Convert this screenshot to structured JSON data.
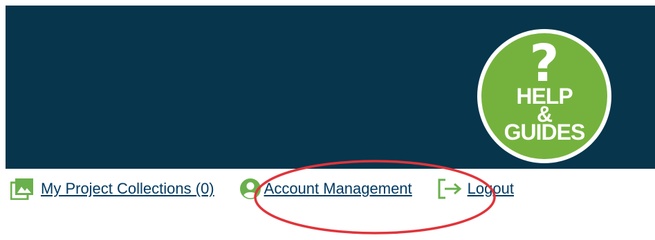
{
  "header": {
    "background_color": "#06354c",
    "help_badge": {
      "symbol": "?",
      "line1": "HELP",
      "line2": "&",
      "line3": "GUIDES",
      "color": "#75b23d",
      "icon": "question-mark-icon"
    }
  },
  "nav": {
    "collections": {
      "label": "My Project Collections (0)",
      "icon": "image-gallery-icon"
    },
    "account": {
      "label": "Account Management",
      "icon": "user-circle-icon"
    },
    "logout": {
      "label": "Logout",
      "icon": "logout-arrow-icon"
    },
    "link_color": "#003a63",
    "icon_color": "#6ab04c"
  },
  "annotation": {
    "shape": "ellipse",
    "color": "#e0343a",
    "target": "Account Management"
  }
}
